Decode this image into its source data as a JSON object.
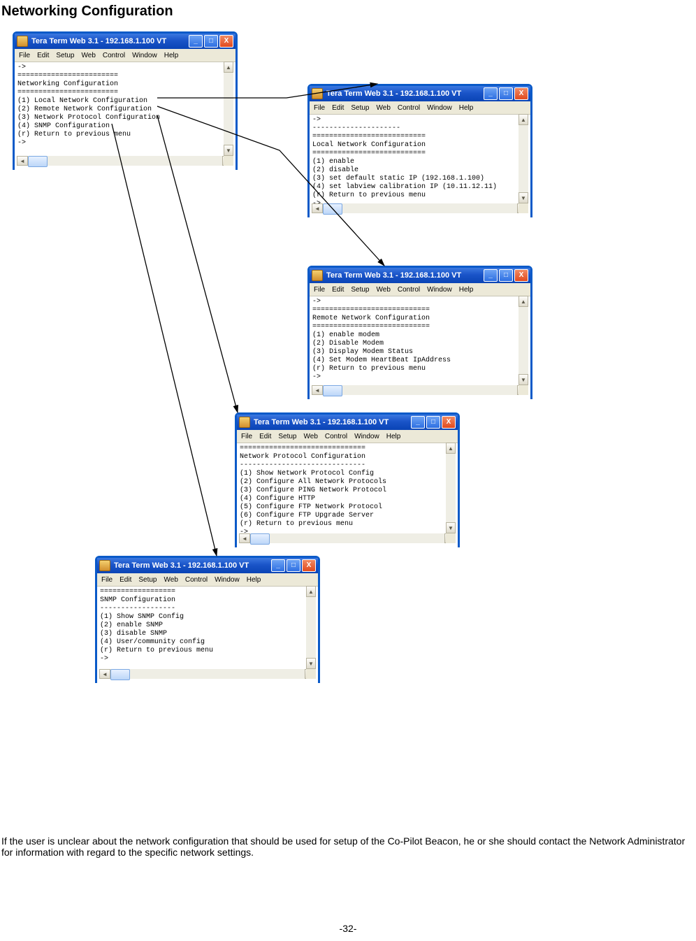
{
  "page_title": "Networking Configuration",
  "titlebar": "Tera Term Web 3.1 - 192.168.1.100 VT",
  "menubar": {
    "file": "File",
    "edit": "Edit",
    "setup": "Setup",
    "web": "Web",
    "control": "Control",
    "window": "Window",
    "help": "Help"
  },
  "win_ctrl": {
    "min": "_",
    "max": "□",
    "close": "X"
  },
  "scroll": {
    "up": "▲",
    "down": "▼",
    "left": "◄",
    "right": "►"
  },
  "w1": "->\n========================\nNetworking Configuration\n========================\n(1) Local Network Configuration\n(2) Remote Network Configuration\n(3) Network Protocol Configuration\n(4) SNMP Configuration\n(r) Return to previous menu\n->",
  "w2": "->\n---------------------\n===========================\nLocal Network Configuration\n===========================\n(1) enable\n(2) disable\n(3) set default static IP (192.168.1.100)\n(4) set labview calibration IP (10.11.12.11)\n(r) Return to previous menu\n->",
  "w3": "->\n============================\nRemote Network Configuration\n============================\n(1) enable modem\n(2) Disable Modem\n(3) Display Modem Status\n(4) Set Modem HeartBeat IpAddress\n(r) Return to previous menu\n->",
  "w4": "==============================\nNetwork Protocol Configuration\n------------------------------\n(1) Show Network Protocol Config\n(2) Configure All Network Protocols\n(3) Configure PING Network Protocol\n(4) Configure HTTP\n(5) Configure FTP Network Protocol\n(6) Configure FTP Upgrade Server\n(r) Return to previous menu\n-> ",
  "w5": "==================\nSNMP Configuration\n------------------\n(1) Show SNMP Config\n(2) enable SNMP\n(3) disable SNMP\n(4) User/community config\n(r) Return to previous menu\n-> ",
  "footer": "If the user is unclear about the network configuration that should be used for setup of the Co-Pilot Beacon, he or she should contact the Network Administrator for information with regard to the specific network settings.",
  "page_number": "-32-"
}
